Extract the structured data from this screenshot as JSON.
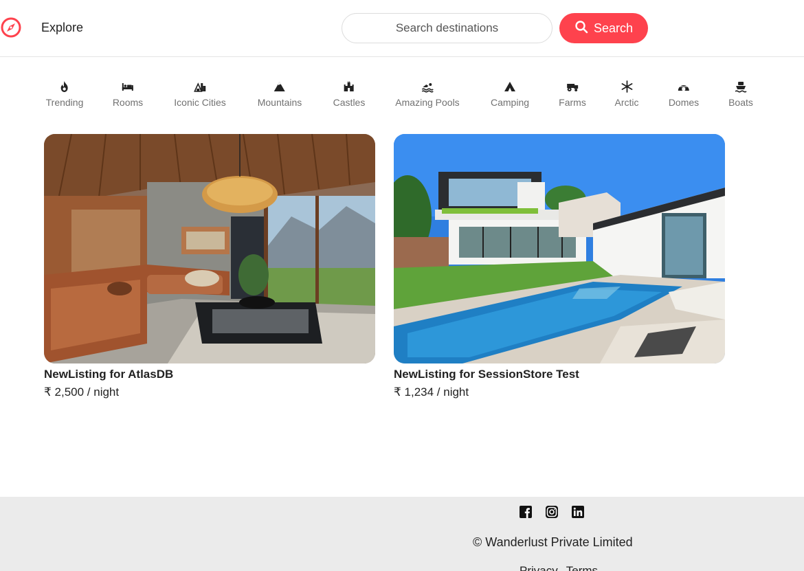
{
  "navbar": {
    "logo_icon": "compass-icon",
    "explore_label": "Explore",
    "search_placeholder": "Search destinations",
    "search_button_label": "Search",
    "accent_color": "#fe424d"
  },
  "filters": [
    {
      "label": "Trending",
      "icon": "fire-icon"
    },
    {
      "label": "Rooms",
      "icon": "bed-icon"
    },
    {
      "label": "Iconic Cities",
      "icon": "city-icon"
    },
    {
      "label": "Mountains",
      "icon": "mountain-icon"
    },
    {
      "label": "Castles",
      "icon": "castle-icon"
    },
    {
      "label": "Amazing Pools",
      "icon": "swimmer-icon"
    },
    {
      "label": "Camping",
      "icon": "tent-icon"
    },
    {
      "label": "Farms",
      "icon": "tractor-icon"
    },
    {
      "label": "Arctic",
      "icon": "snowflake-icon"
    },
    {
      "label": "Domes",
      "icon": "igloo-icon"
    },
    {
      "label": "Boats",
      "icon": "ship-icon"
    }
  ],
  "listings": [
    {
      "title": "NewListing for AtlasDB",
      "price": "₹ 2,500 / night"
    },
    {
      "title": "NewListing for SessionStore Test",
      "price": "₹ 1,234 / night"
    }
  ],
  "footer": {
    "social_icons": [
      "facebook-icon",
      "instagram-icon",
      "linkedin-icon"
    ],
    "copyright": "© Wanderlust Private Limited",
    "privacy_label": "Privacy",
    "terms_label": "Terms"
  }
}
